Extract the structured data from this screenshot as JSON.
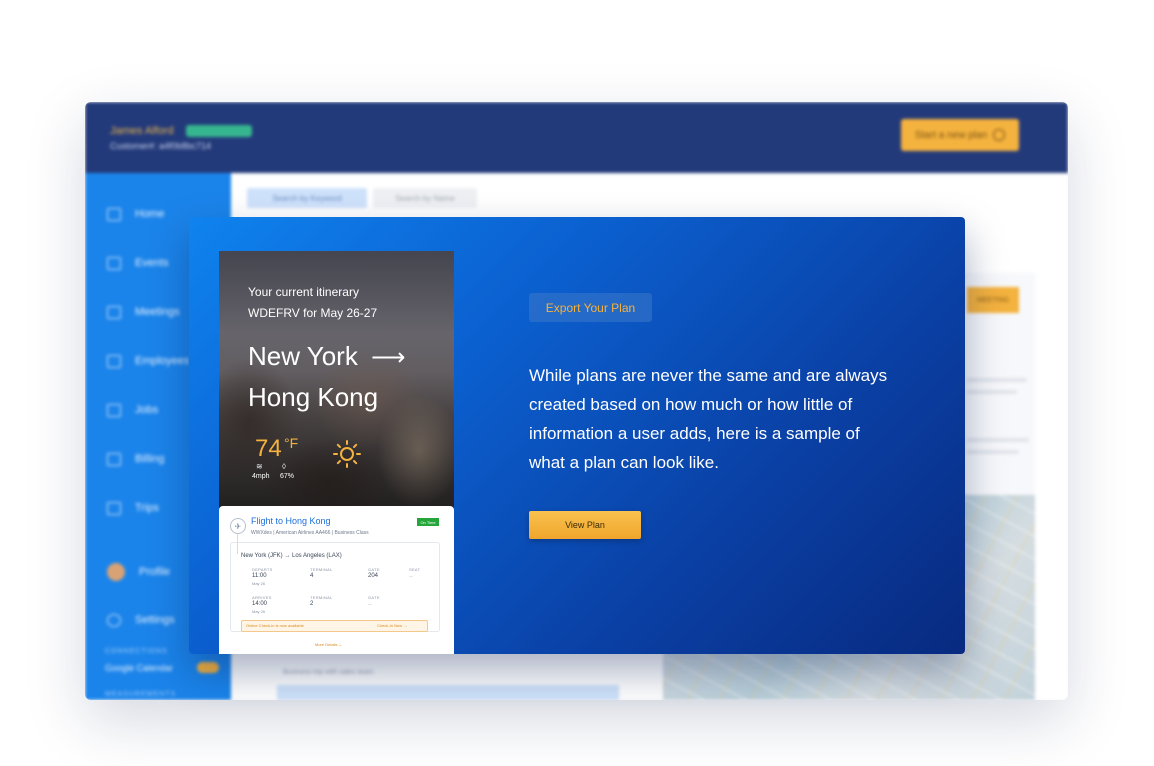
{
  "background_app": {
    "user_name": "James Alford",
    "user_badge": "",
    "customer_number": "Customer#: a4f0b8bc714",
    "new_plan_label": "Start a new plan",
    "sidebar": {
      "items": [
        {
          "label": "Home",
          "icon": "home-icon"
        },
        {
          "label": "Events",
          "icon": "calendar-icon"
        },
        {
          "label": "Meetings",
          "icon": "calendar-icon"
        },
        {
          "label": "Employees",
          "icon": "id-card-icon"
        },
        {
          "label": "Jobs",
          "icon": "document-icon"
        },
        {
          "label": "Billing",
          "icon": "billing-icon"
        },
        {
          "label": "Trips",
          "icon": "trips-icon"
        },
        {
          "label": "Profile",
          "icon": "avatar"
        },
        {
          "label": "Settings",
          "icon": "gear-icon"
        }
      ],
      "connections_label": "CONNECTIONS",
      "google_calendar_label": "Google Calendar",
      "measurements_label": "MEASUREMENTS"
    },
    "tabs": {
      "keyword": "Search by Keyword",
      "name": "Search by Name"
    },
    "meeting_button": "MEETING",
    "card_subtitle": "Business trip with sales team"
  },
  "modal": {
    "itinerary_label": "Your current itinerary",
    "itinerary_code": "WDEFRV for May 26-27",
    "origin_city": "New York",
    "arrow": "⟶",
    "destination_city": "Hong Kong",
    "temperature": "74",
    "temperature_unit": "°F",
    "wind": "4mph",
    "precipitation": "67%",
    "flight": {
      "title": "Flight to Hong Kong",
      "subtitle": "WWXdes  |  American Airlines AA466  |  Business Class",
      "status": "On Time",
      "route": "New York (JFK) → Los Angeles (LAX)",
      "departs_label": "DEPARTS",
      "departs_time": "11:00",
      "departs_date": "May 26",
      "terminal_label": "TERMINAL",
      "terminal_dep": "4",
      "gate_label": "GATE",
      "gate_dep": "204",
      "seat_label": "SEAT",
      "seat_val": "---",
      "arrives_label": "ARRIVES",
      "arrives_time": "14:00",
      "arrives_date": "May 26",
      "terminal_arr": "2",
      "gate_arr": "---",
      "checkin_text": "Online Check-in is now available",
      "checkin_link": "Check-In Now →",
      "more_details": "More Details ⌄"
    },
    "export_label": "Export Your Plan",
    "description": "While plans are never the same and are always created based on how much or how little of information a user adds, here is a sample of what a plan can look like.",
    "view_plan_label": "View Plan"
  },
  "colors": {
    "header": "#233a7a",
    "sidebar": "#1b84ea",
    "accent": "#f4b23e",
    "link_blue": "#1b6fd8",
    "modal_start": "#0f83ee",
    "modal_end": "#082a80"
  }
}
